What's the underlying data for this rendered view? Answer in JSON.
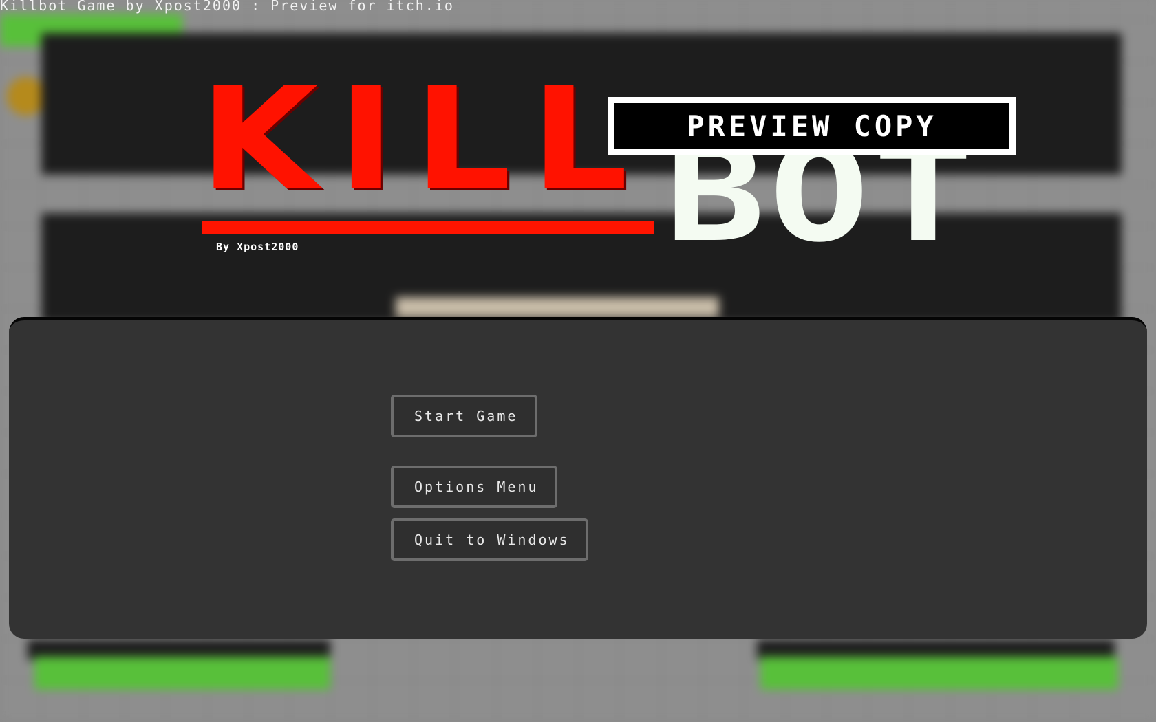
{
  "window": {
    "title": "Killbot Game by Xpost2000 : Preview for itch.io"
  },
  "logo": {
    "kill_text": "KILL",
    "bot_text": "BOT",
    "preview_badge": "PREVIEW COPY",
    "byline": "By Xpost2000"
  },
  "menu": {
    "start_label": "Start Game",
    "options_label": "Options Menu",
    "quit_label": "Quit to Windows"
  },
  "colors": {
    "kill_red": "#ff1200",
    "bot_white": "#f4fbf2",
    "panel_bg": "#333333",
    "button_border": "#6d6d6d",
    "button_text": "#e8e8e8"
  }
}
